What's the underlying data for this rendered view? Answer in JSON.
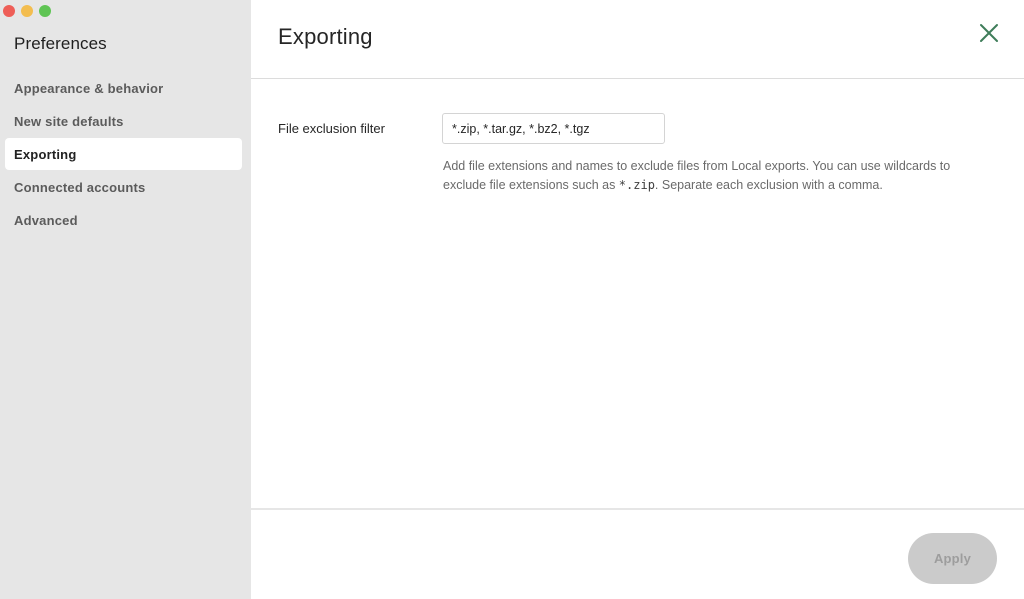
{
  "window": {
    "traffic_lights": [
      "close",
      "minimize",
      "zoom"
    ]
  },
  "sidebar": {
    "title": "Preferences",
    "items": [
      {
        "label": "Appearance & behavior",
        "active": false
      },
      {
        "label": "New site defaults",
        "active": false
      },
      {
        "label": "Exporting",
        "active": true
      },
      {
        "label": "Connected accounts",
        "active": false
      },
      {
        "label": "Advanced",
        "active": false
      }
    ]
  },
  "header": {
    "title": "Exporting",
    "close_icon": "close-icon",
    "accent_color": "#3f7d5a"
  },
  "exporting": {
    "filter_label": "File exclusion filter",
    "filter_value": "*.zip, *.tar.gz, *.bz2, *.tgz",
    "help_before": "Add file extensions and names to exclude files from Local exports. You can use wildcards to exclude file extensions such as ",
    "help_code": "*.zip",
    "help_after": ". Separate each exclusion with a comma."
  },
  "footer": {
    "apply_label": "Apply",
    "apply_enabled": false
  }
}
